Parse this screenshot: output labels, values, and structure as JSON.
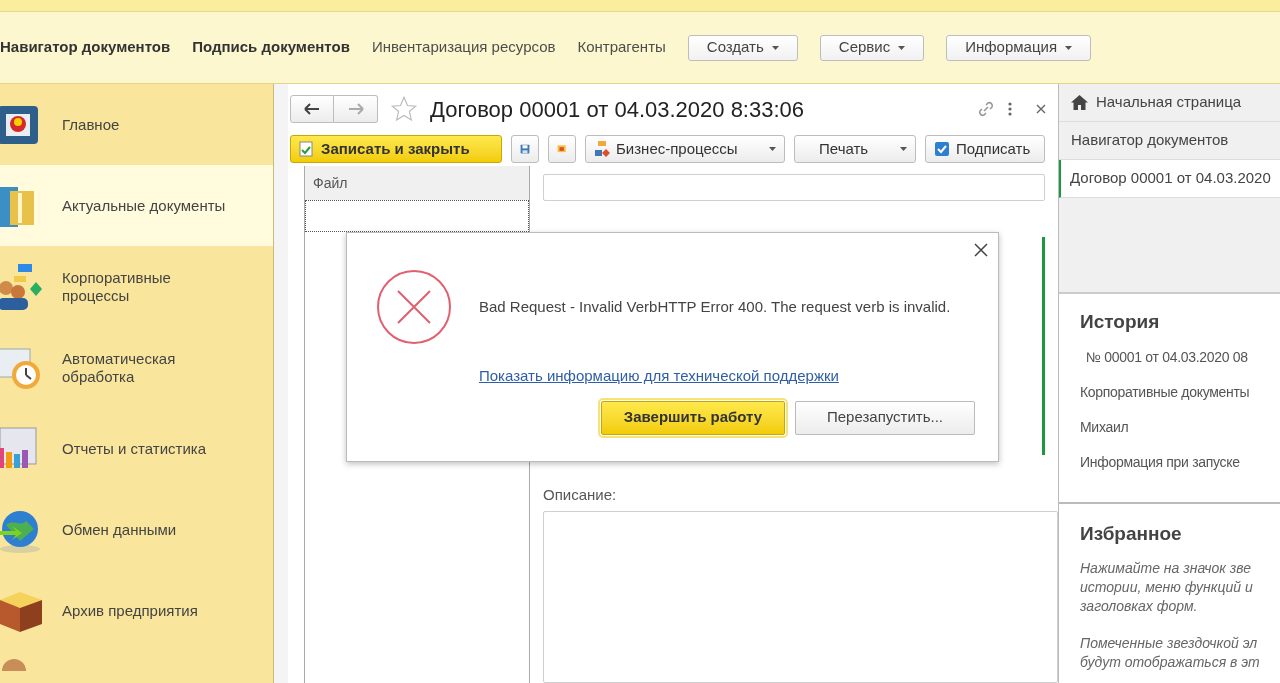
{
  "top_menu": [
    {
      "label": "Навигатор документов",
      "bold": true
    },
    {
      "label": "Подпись документов",
      "bold": true
    },
    {
      "label": "Инвентаризация ресурсов",
      "bold": false
    },
    {
      "label": "Контрагенты",
      "bold": false
    }
  ],
  "top_dropdowns": [
    "Создать",
    "Сервис",
    "Информация"
  ],
  "sections": [
    {
      "label": "Главное",
      "selected": false,
      "kind": "cube"
    },
    {
      "label": "Актуальные документы",
      "selected": true,
      "kind": "folder"
    },
    {
      "label": "Корпоративные процессы",
      "selected": false,
      "kind": "people"
    },
    {
      "label": "Автоматическая обработка",
      "selected": false,
      "kind": "clock"
    },
    {
      "label": "Отчеты и статистика",
      "selected": false,
      "kind": "reports"
    },
    {
      "label": "Обмен данными",
      "selected": false,
      "kind": "globe"
    },
    {
      "label": "Архив предприятия",
      "selected": false,
      "kind": "box"
    }
  ],
  "form": {
    "title": "Договор 00001 от 04.03.2020 8:33:06",
    "save_close": "Записать и закрыть",
    "business": "Бизнес-процессы",
    "print": "Печать",
    "sign": "Подписать",
    "file_column": "Файл",
    "description_label": "Описание:"
  },
  "dialog": {
    "message": "Bad Request - Invalid VerbHTTP Error 400. The request verb is invalid.",
    "link": "Показать информацию для технической поддержки",
    "buttons": [
      {
        "label": "Завершить работу",
        "selected": true
      },
      {
        "label": "Перезапустить...",
        "selected": false
      }
    ]
  },
  "open_windows": [
    {
      "label": "Начальная страница",
      "selected": false
    },
    {
      "label": "Навигатор документов",
      "selected": false
    },
    {
      "label": "Договор 00001 от 04.03.2020",
      "selected": true
    }
  ],
  "history": {
    "title": "История",
    "items": [
      "№ 00001 от 04.03.2020 08",
      "Корпоративные документы",
      "Михаил",
      "Информация при запуске"
    ]
  },
  "favorites": {
    "title": "Избранное",
    "paragraphs": [
      "Нажимайте на значок зве истории, меню функций и заголовках форм.",
      "Помеченные звездочкой эл будут отображаться в эт"
    ]
  }
}
